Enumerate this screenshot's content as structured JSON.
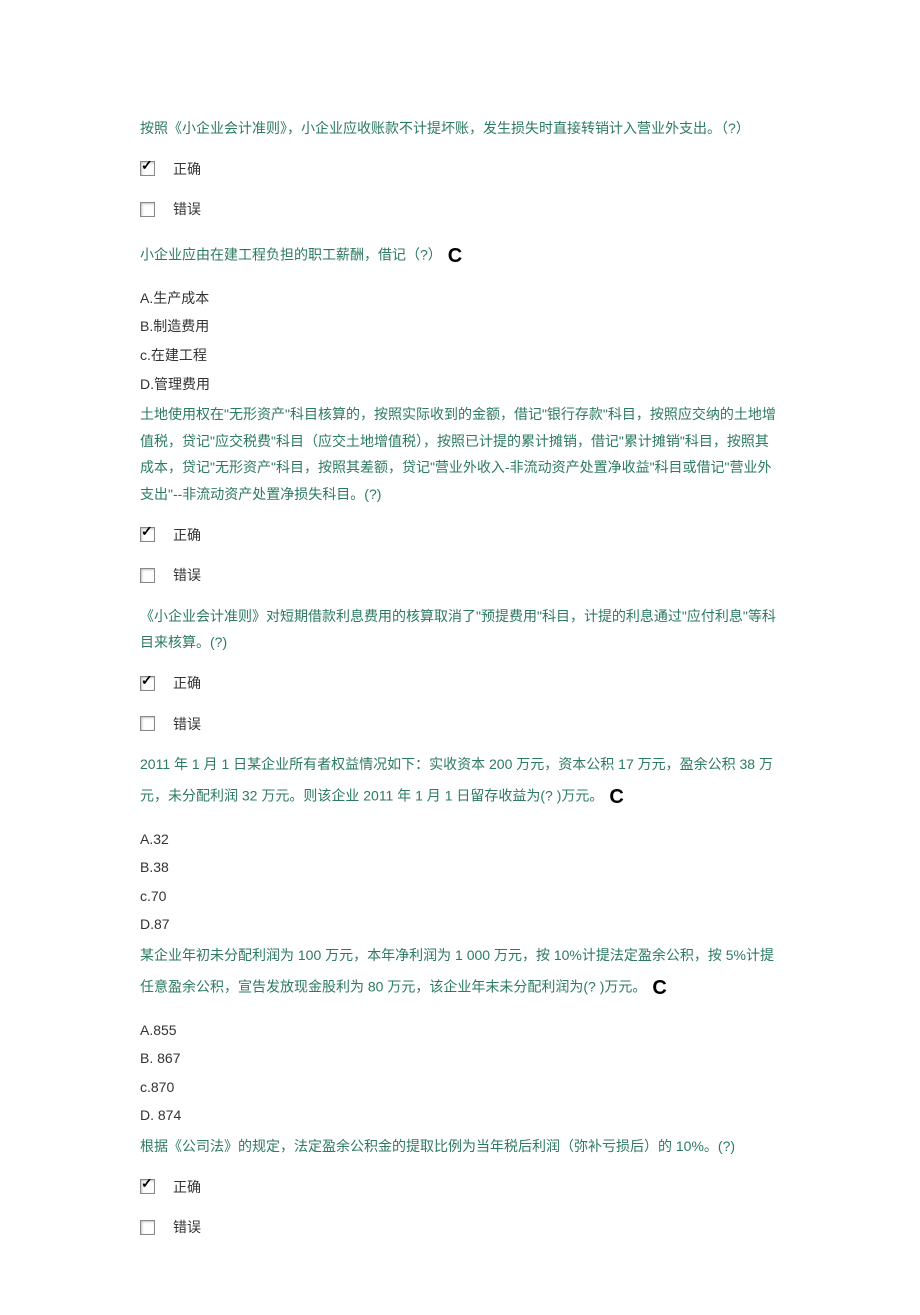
{
  "labels": {
    "correct": "正确",
    "incorrect": "错误"
  },
  "questions": [
    {
      "type": "tf",
      "text": "按照《小企业会计准则》，小企业应收账款不计提坏账，发生损失时直接转销计入营业外支出。（?）",
      "correctChecked": true,
      "incorrectChecked": false
    },
    {
      "type": "mc",
      "text": "小企业应由在建工程负担的职工薪酬，借记（?）",
      "answer": "C",
      "options": [
        "A.生产成本",
        "B.制造费用",
        "c.在建工程",
        "D.管理费用"
      ]
    },
    {
      "type": "tf",
      "text": "土地使用权在\"无形资产\"科目核算的，按照实际收到的金额，借记\"银行存款\"科目，按照应交纳的土地增值税，贷记\"应交税费\"科目（应交土地增值税），按照已计提的累计摊销，借记\"累计摊销\"科目，按照其成本，贷记\"无形资产\"科目，按照其差额，贷记\"营业外收入-非流动资产处置净收益\"科目或借记\"营业外支出\"--非流动资产处置净损失科目。(?)",
      "correctChecked": true,
      "incorrectChecked": false
    },
    {
      "type": "tf",
      "text": "《小企业会计准则》对短期借款利息费用的核算取消了\"预提费用\"科目，计提的利息通过\"应付利息\"等科目来核算。(?)",
      "correctChecked": true,
      "incorrectChecked": false
    },
    {
      "type": "mc",
      "text": "2011 年 1 月 1 日某企业所有者权益情况如下：实收资本 200 万元，资本公积 17 万元，盈余公积 38 万元，未分配利润 32 万元。则该企业 2011 年 1 月 1 日留存收益为(? )万元。",
      "answer": "C",
      "options": [
        "A.32",
        "B.38",
        "c.70",
        "D.87"
      ]
    },
    {
      "type": "mc",
      "text": "某企业年初未分配利润为 100 万元，本年净利润为 1 000 万元，按 10%计提法定盈余公积，按 5%计提任意盈余公积，宣告发放现金股利为 80 万元，该企业年末未分配利润为(? )万元。",
      "answer": "C",
      "options": [
        "A.855",
        "B. 867",
        "c.870",
        "D. 874"
      ]
    },
    {
      "type": "tf",
      "text": "根据《公司法》的规定，法定盈余公积金的提取比例为当年税后利润（弥补亏损后）的 10%。(?)",
      "correctChecked": true,
      "incorrectChecked": false
    }
  ]
}
